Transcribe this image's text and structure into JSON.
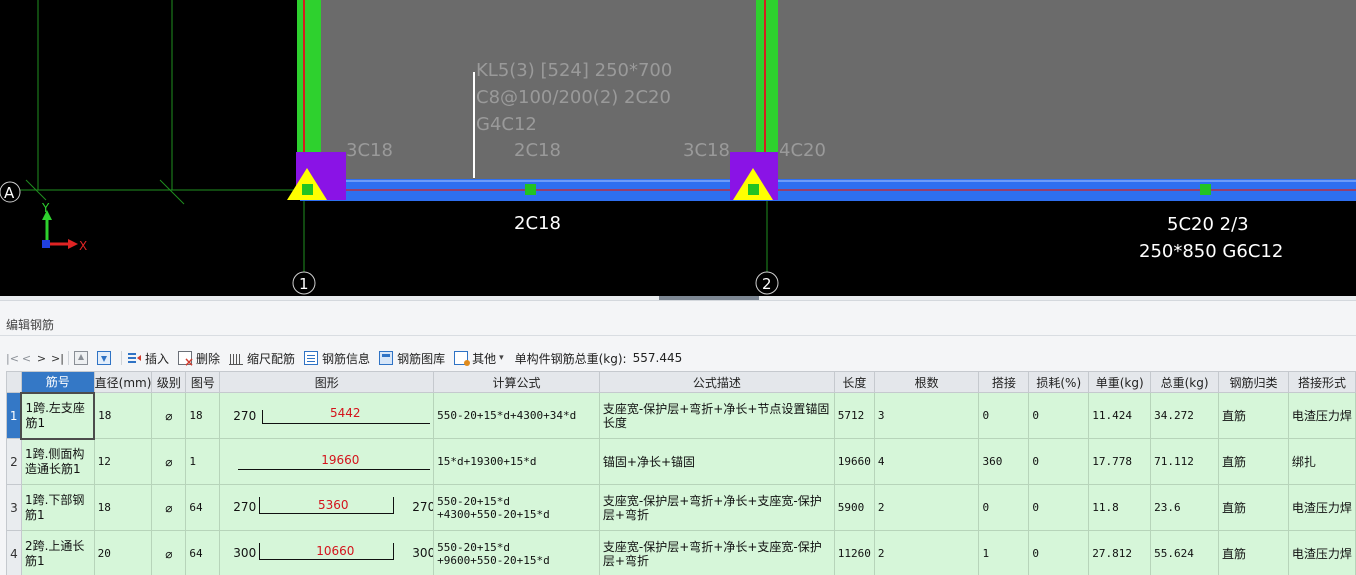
{
  "cad": {
    "beam_label_line1": "KL5(3) [524] 250*700",
    "beam_label_line2": "C8@100/200(2) 2C20",
    "beam_label_line3": "G4C12",
    "rebar_3c18_left": "3C18",
    "rebar_2c18_top": "2C18",
    "rebar_3c18_right": "3C18",
    "rebar_4c20": "4C20",
    "rebar_2c18_bottom": "2C18",
    "span3_label_line1": "5C20 2/3",
    "span3_label_line2": "250*850 G6C12",
    "axis_a": "A",
    "axis_1": "1",
    "axis_2": "2",
    "ucs_x": "X",
    "ucs_y": "Y",
    "colors": {
      "column": "#2ed12e",
      "support": "#8a13e6",
      "beam": "#2e6ff0",
      "centerline": "#d42020",
      "marker": "#ffff00",
      "grid": "#1f8f1f",
      "slab": "#6b6b6b"
    }
  },
  "panel": {
    "title": "编辑钢筋"
  },
  "toolbar": {
    "nav_first": "|<",
    "nav_prev": "<",
    "nav_next": ">",
    "nav_last": ">|",
    "insert": "插入",
    "delete": "删除",
    "scale_rebar": "缩尺配筋",
    "rebar_info": "钢筋信息",
    "rebar_library": "钢筋图库",
    "other": "其他",
    "total_weight_label": "单构件钢筋总重(kg):",
    "total_weight_value": "557.445",
    "icons": [
      "move-up-icon",
      "move-down-icon",
      "insert-icon",
      "delete-icon",
      "scale-icon",
      "info-icon",
      "library-icon",
      "other-icon"
    ]
  },
  "grid": {
    "headers": [
      "筋号",
      "直径(mm)",
      "级别",
      "图号",
      "图形",
      "计算公式",
      "公式描述",
      "长度",
      "根数",
      "搭接",
      "损耗(%)",
      "单重(kg)",
      "总重(kg)",
      "钢筋归类",
      "搭接形式"
    ],
    "rows": [
      {
        "idx": "1",
        "name": "1跨.左支座筋1",
        "diameter": "18",
        "grade": "⌀",
        "figure_no": "18",
        "shape_left": "270",
        "shape_mid": "5442",
        "shape_right": "",
        "formula_line1": "550-20+15*d+4300+34*d",
        "formula_line2": "",
        "description": "支座宽-保护层+弯折+净长+节点设置锚固长度",
        "length": "5712",
        "count": "3",
        "lap": "0",
        "loss": "0",
        "unit_weight": "11.424",
        "total_weight": "34.272",
        "category": "直筋",
        "lap_type": "电渣压力焊"
      },
      {
        "idx": "2",
        "name": "1跨.侧面构造通长筋1",
        "diameter": "12",
        "grade": "⌀",
        "figure_no": "1",
        "shape_left": "",
        "shape_mid": "19660",
        "shape_right": "",
        "formula_line1": "15*d+19300+15*d",
        "formula_line2": "",
        "description": "锚固+净长+锚固",
        "length": "19660",
        "count": "4",
        "lap": "360",
        "loss": "0",
        "unit_weight": "17.778",
        "total_weight": "71.112",
        "category": "直筋",
        "lap_type": "绑扎"
      },
      {
        "idx": "3",
        "name": "1跨.下部钢筋1",
        "diameter": "18",
        "grade": "⌀",
        "figure_no": "64",
        "shape_left": "270",
        "shape_mid": "5360",
        "shape_right": "270",
        "formula_line1": "550-20+15*d",
        "formula_line2": "+4300+550-20+15*d",
        "description": "支座宽-保护层+弯折+净长+支座宽-保护层+弯折",
        "length": "5900",
        "count": "2",
        "lap": "0",
        "loss": "0",
        "unit_weight": "11.8",
        "total_weight": "23.6",
        "category": "直筋",
        "lap_type": "电渣压力焊"
      },
      {
        "idx": "4",
        "name": "2跨.上通长筋1",
        "diameter": "20",
        "grade": "⌀",
        "figure_no": "64",
        "shape_left": "300",
        "shape_mid": "10660",
        "shape_right": "300",
        "formula_line1": "550-20+15*d",
        "formula_line2": "+9600+550-20+15*d",
        "description": "支座宽-保护层+弯折+净长+支座宽-保护层+弯折",
        "length": "11260",
        "count": "2",
        "lap": "1",
        "loss": "0",
        "unit_weight": "27.812",
        "total_weight": "55.624",
        "category": "直筋",
        "lap_type": "电渣压力焊"
      }
    ]
  }
}
